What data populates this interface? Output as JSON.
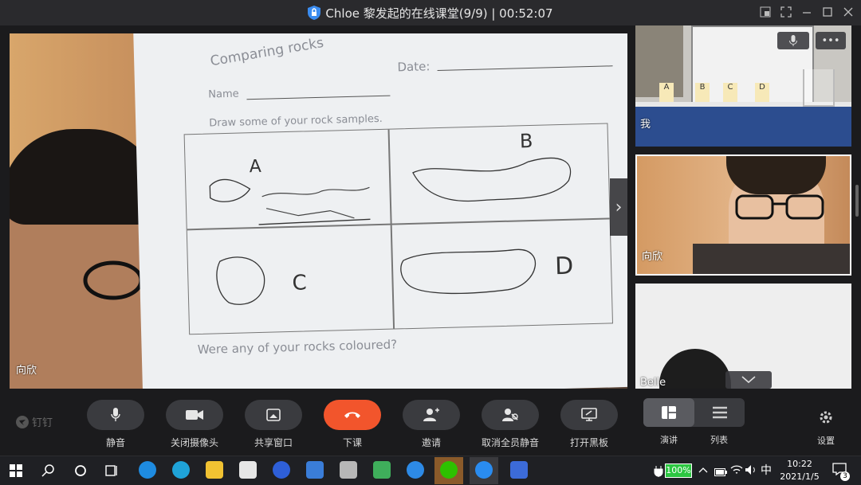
{
  "window": {
    "title": "Chloe 黎发起的在线课堂(9/9) | 00:52:07"
  },
  "main_video": {
    "participant_name": "向欣",
    "worksheet": {
      "heading": "Comparing rocks",
      "name_label": "Name",
      "date_label": "Date:",
      "instruction": "Draw some of your rock samples.",
      "cell_labels": [
        "A",
        "B",
        "C",
        "D"
      ],
      "footer_question": "Were any of your rocks coloured?"
    }
  },
  "side_tiles": [
    {
      "name": "我",
      "labels_on_desk": [
        "A",
        "B",
        "C",
        "D"
      ]
    },
    {
      "name": "向欣"
    },
    {
      "name": "Belle"
    }
  ],
  "side_tile_controls": {
    "more_label": "•••"
  },
  "brand": {
    "label": "钉钉"
  },
  "toolbar": {
    "buttons": [
      {
        "id": "mute",
        "label": "静音"
      },
      {
        "id": "camera",
        "label": "关闭摄像头"
      },
      {
        "id": "share",
        "label": "共享窗口"
      },
      {
        "id": "end",
        "label": "下课"
      },
      {
        "id": "invite",
        "label": "邀请"
      },
      {
        "id": "unmute_all",
        "label": "取消全员静音"
      },
      {
        "id": "blackboard",
        "label": "打开黑板"
      }
    ],
    "view_modes": [
      {
        "id": "speaker",
        "label": "演讲",
        "selected": true
      },
      {
        "id": "list",
        "label": "列表",
        "selected": false
      }
    ],
    "settings_label": "设置"
  },
  "taskbar": {
    "battery": "100%",
    "ime": "中",
    "time": "10:22",
    "date": "2021/1/5",
    "notifications": "3"
  },
  "colors": {
    "end_call": "#f2552c",
    "button_bg": "#3a3b3f",
    "bg": "#1b1b1d"
  }
}
